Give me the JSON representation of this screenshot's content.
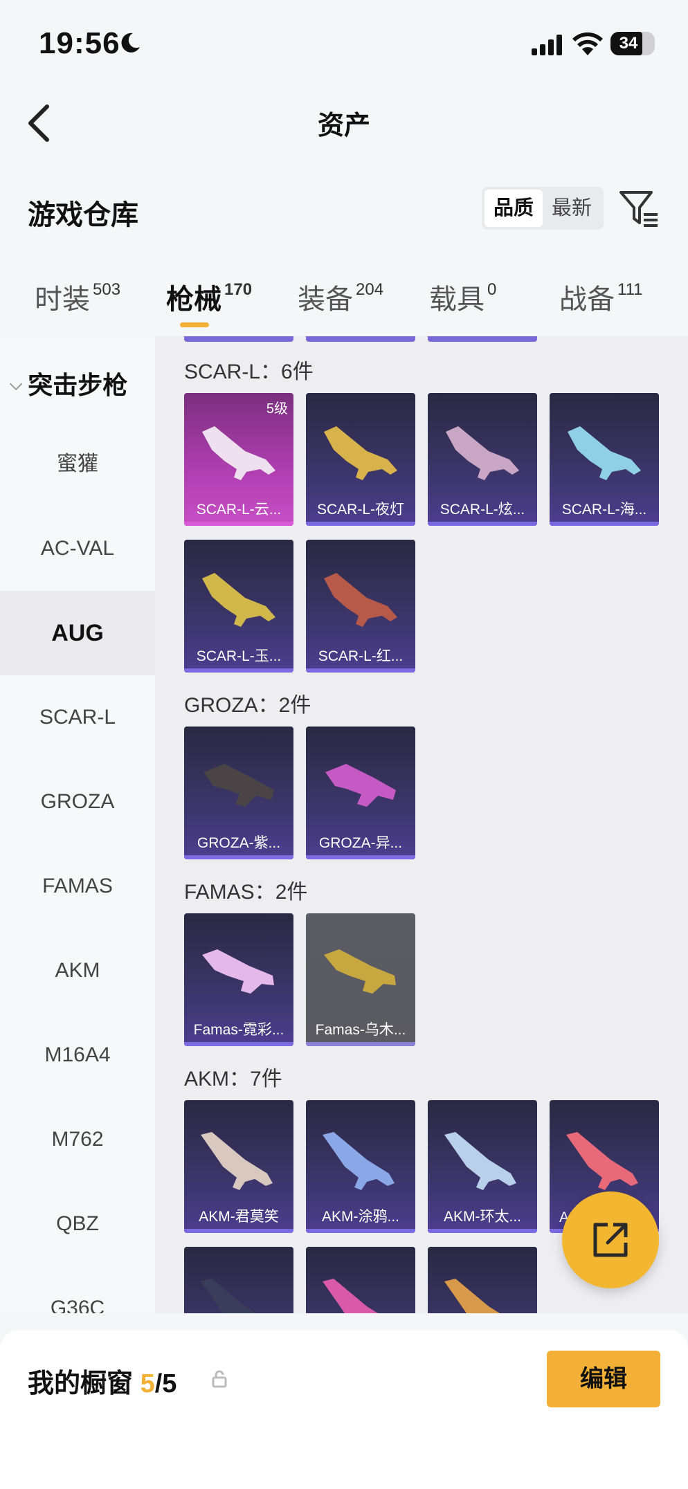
{
  "status_bar": {
    "time": "19:56",
    "battery": "34"
  },
  "header": {
    "title": "资产",
    "warehouse_title": "游戏仓库",
    "sort_options": [
      "品质",
      "最新"
    ]
  },
  "tabs": [
    {
      "label": "时装",
      "count": "503"
    },
    {
      "label": "枪械",
      "count": "170"
    },
    {
      "label": "装备",
      "count": "204"
    },
    {
      "label": "载具",
      "count": "0"
    },
    {
      "label": "战备",
      "count": "111"
    }
  ],
  "sidebar": {
    "heading": "突击步枪",
    "items": [
      "蜜獾",
      "AC-VAL",
      "AUG",
      "SCAR-L",
      "GROZA",
      "FAMAS",
      "AKM",
      "M16A4",
      "M762",
      "QBZ",
      "G36C"
    ],
    "active": "AUG"
  },
  "sections": [
    {
      "title": "SCAR-L：6件",
      "items": [
        {
          "name": "SCAR-L-云...",
          "level": "5级",
          "style": "pink"
        },
        {
          "name": "SCAR-L-夜灯"
        },
        {
          "name": "SCAR-L-炫..."
        },
        {
          "name": "SCAR-L-海..."
        },
        {
          "name": "SCAR-L-玉..."
        },
        {
          "name": "SCAR-L-红..."
        }
      ]
    },
    {
      "title": "GROZA：2件",
      "items": [
        {
          "name": "GROZA-紫..."
        },
        {
          "name": "GROZA-异..."
        }
      ]
    },
    {
      "title": "FAMAS：2件",
      "items": [
        {
          "name": "Famas-霓彩..."
        },
        {
          "name": "Famas-乌木...",
          "style": "grey"
        }
      ]
    },
    {
      "title": "AKM：7件",
      "items": [
        {
          "name": "AKM-君莫笑"
        },
        {
          "name": "AKM-涂鸦..."
        },
        {
          "name": "AKM-环太..."
        },
        {
          "name": "A"
        },
        {
          "name": ""
        },
        {
          "name": ""
        },
        {
          "name": ""
        }
      ]
    }
  ],
  "showcase": {
    "label": "我的橱窗",
    "count": "5",
    "total": "/5",
    "edit_label": "编辑"
  },
  "colors": {
    "accent": "#f2b136",
    "card_purple": "#4c3d8f",
    "card_pink": "#c64fc4"
  }
}
